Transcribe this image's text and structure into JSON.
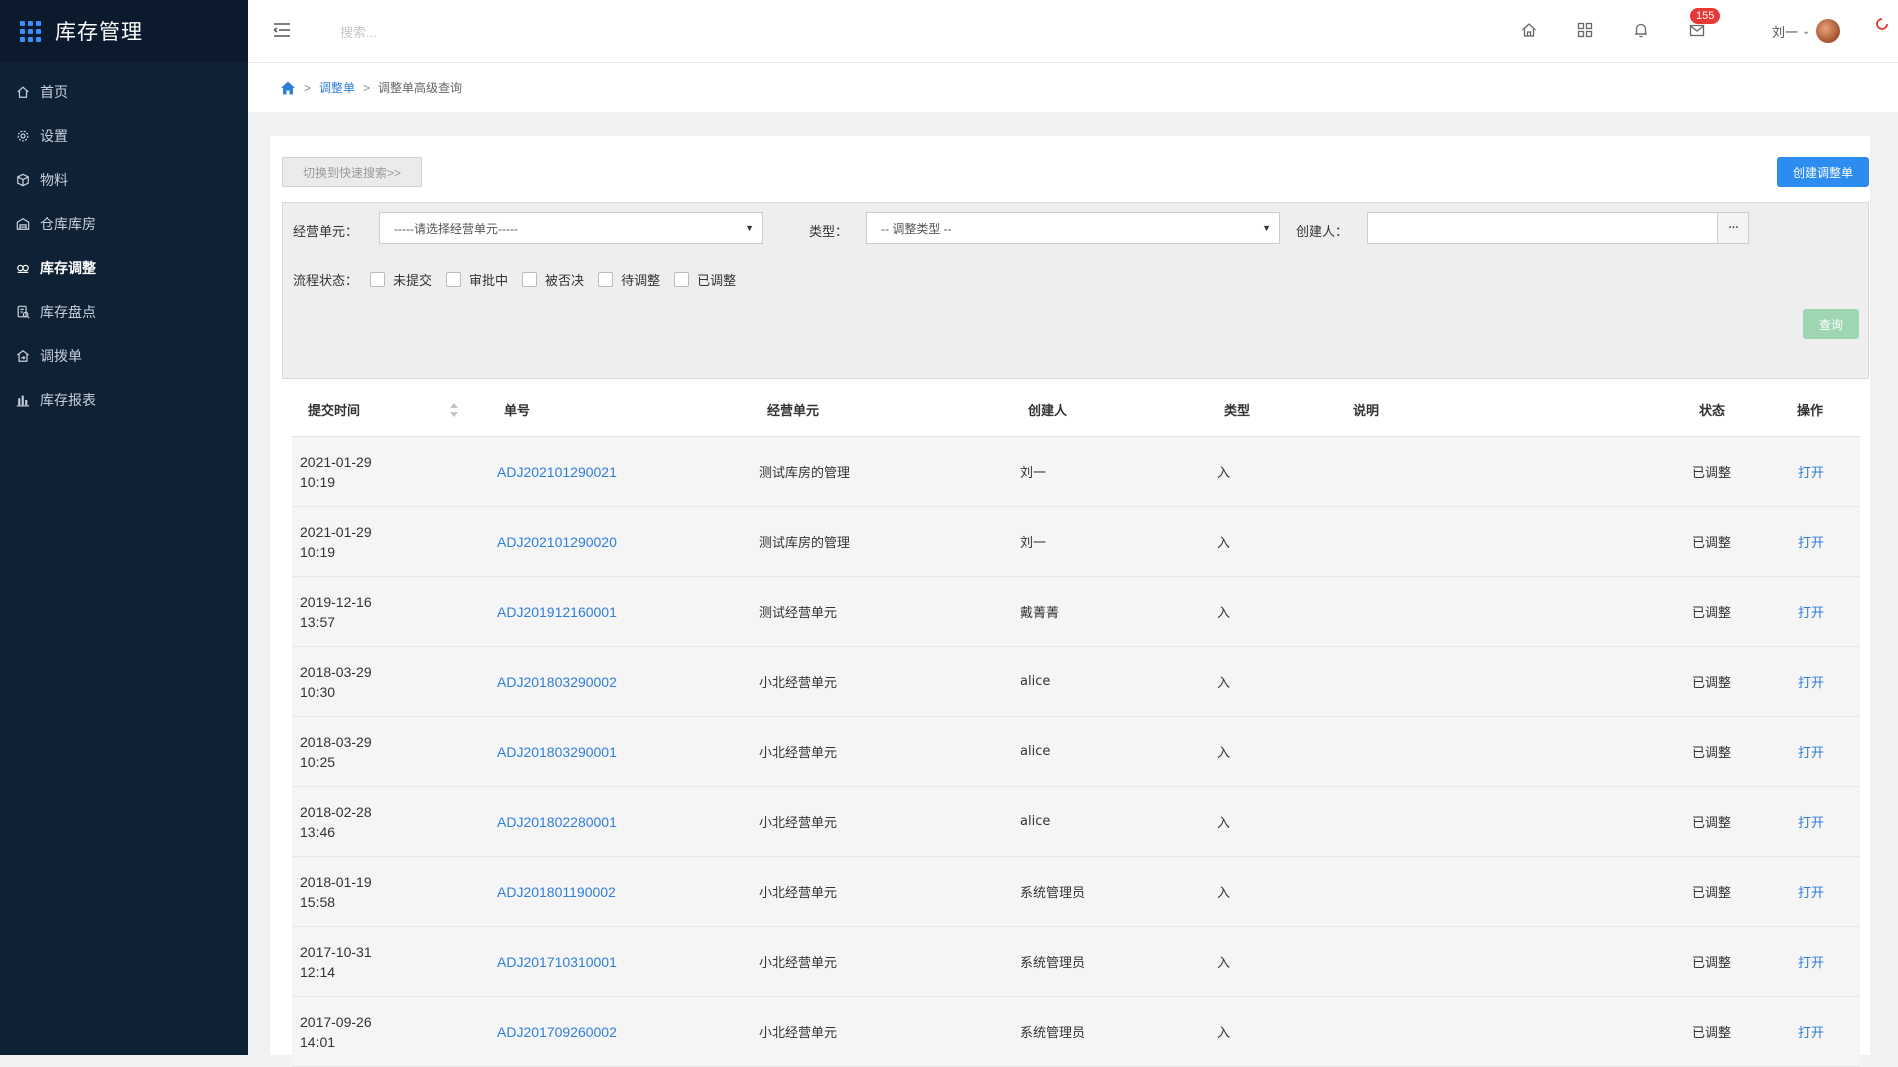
{
  "app": {
    "title": "库存管理"
  },
  "sidebar": {
    "items": [
      {
        "label": "首页",
        "icon": "home-icon"
      },
      {
        "label": "设置",
        "icon": "gear-icon"
      },
      {
        "label": "物料",
        "icon": "cube-icon"
      },
      {
        "label": "仓库库房",
        "icon": "warehouse-icon"
      },
      {
        "label": "库存调整",
        "icon": "adjust-icon"
      },
      {
        "label": "库存盘点",
        "icon": "inventory-check-icon"
      },
      {
        "label": "调拨单",
        "icon": "transfer-icon"
      },
      {
        "label": "库存报表",
        "icon": "bar-chart-icon"
      }
    ],
    "active_index": 4
  },
  "header": {
    "search_placeholder": "搜索...",
    "mail_badge": "155",
    "user_name": "刘一"
  },
  "breadcrumb": {
    "level1": "调整单",
    "level2": "调整单高级查询"
  },
  "toolbar": {
    "switch_label": "切换到快速搜索>>",
    "create_label": "创建调整单"
  },
  "filters": {
    "unit_label": "经营单元：",
    "unit_value": "-----请选择经营单元-----",
    "type_label": "类型：",
    "type_value": "-- 调整类型 --",
    "creator_label": "创建人：",
    "creator_value": "",
    "status_label": "流程状态：",
    "status_options": [
      "未提交",
      "审批中",
      "被否决",
      "待调整",
      "已调整"
    ],
    "query_label": "查询"
  },
  "table": {
    "headers": {
      "time": "提交时间",
      "number": "单号",
      "unit": "经营单元",
      "creator": "创建人",
      "type": "类型",
      "desc": "说明",
      "status": "状态",
      "action": "操作"
    },
    "rows": [
      {
        "date": "2021-01-29",
        "time": "10:19",
        "number": "ADJ202101290021",
        "unit": "测试库房的管理",
        "creator": "刘一",
        "type": "入",
        "desc": "",
        "status": "已调整",
        "action": "打开"
      },
      {
        "date": "2021-01-29",
        "time": "10:19",
        "number": "ADJ202101290020",
        "unit": "测试库房的管理",
        "creator": "刘一",
        "type": "入",
        "desc": "",
        "status": "已调整",
        "action": "打开"
      },
      {
        "date": "2019-12-16",
        "time": "13:57",
        "number": "ADJ201912160001",
        "unit": "测试经营单元",
        "creator": "戴菁菁",
        "type": "入",
        "desc": "",
        "status": "已调整",
        "action": "打开"
      },
      {
        "date": "2018-03-29",
        "time": "10:30",
        "number": "ADJ201803290002",
        "unit": "小北经营单元",
        "creator": "alice",
        "type": "入",
        "desc": "",
        "status": "已调整",
        "action": "打开"
      },
      {
        "date": "2018-03-29",
        "time": "10:25",
        "number": "ADJ201803290001",
        "unit": "小北经营单元",
        "creator": "alice",
        "type": "入",
        "desc": "",
        "status": "已调整",
        "action": "打开"
      },
      {
        "date": "2018-02-28",
        "time": "13:46",
        "number": "ADJ201802280001",
        "unit": "小北经营单元",
        "creator": "alice",
        "type": "入",
        "desc": "",
        "status": "已调整",
        "action": "打开"
      },
      {
        "date": "2018-01-19",
        "time": "15:58",
        "number": "ADJ201801190002",
        "unit": "小北经营单元",
        "creator": "系统管理员",
        "type": "入",
        "desc": "",
        "status": "已调整",
        "action": "打开"
      },
      {
        "date": "2017-10-31",
        "time": "12:14",
        "number": "ADJ201710310001",
        "unit": "小北经营单元",
        "creator": "系统管理员",
        "type": "入",
        "desc": "",
        "status": "已调整",
        "action": "打开"
      },
      {
        "date": "2017-09-26",
        "time": "14:01",
        "number": "ADJ201709260002",
        "unit": "小北经营单元",
        "creator": "系统管理员",
        "type": "入",
        "desc": "",
        "status": "已调整",
        "action": "打开"
      }
    ]
  },
  "colors": {
    "sidebar_bg": "#0e2135",
    "primary": "#2d8cf0",
    "link": "#2f7ed8",
    "query_button": "#9ed6b2",
    "badge": "#e53935"
  }
}
